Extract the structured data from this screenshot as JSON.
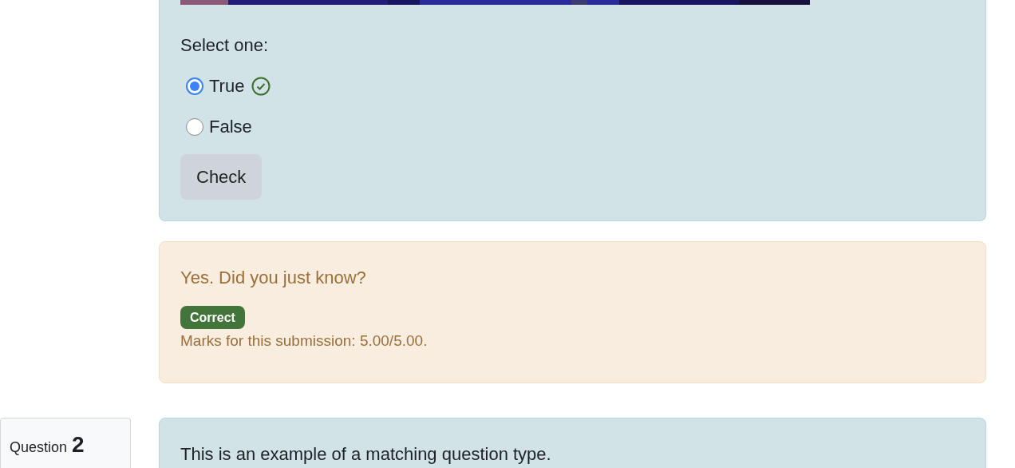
{
  "question_1": {
    "prompt": "Select one:",
    "options": [
      {
        "label": "True",
        "selected": true,
        "correct": true
      },
      {
        "label": "False",
        "selected": false,
        "correct": false
      }
    ],
    "check_button": "Check"
  },
  "feedback": {
    "message": "Yes. Did you just know?",
    "status_badge": "Correct",
    "marks": "Marks for this submission: 5.00/5.00."
  },
  "question_2": {
    "label": "Question",
    "number": "2",
    "text": "This is an example of a matching question type."
  }
}
